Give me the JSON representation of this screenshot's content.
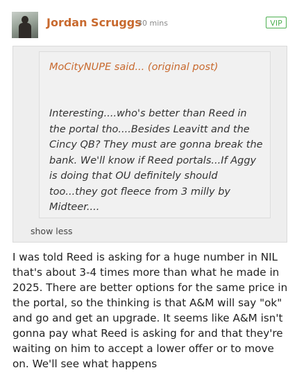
{
  "post": {
    "author": "Jordan Scruggs",
    "timestamp": "30 mins",
    "badge": "VIP",
    "avatar_icon": "user-avatar",
    "quote": {
      "author_text": "MoCityNUPE said...",
      "link_open": "(",
      "link_text": "original post",
      "link_close": ")",
      "text": "Interesting....who's better than Reed in the portal tho....Besides Leavitt and the Cincy QB? They must are gonna break the bank. We'll know if Reed portals...If Aggy is doing that OU definitely should too...they got fleece from 3 milly by Midteer....",
      "toggle_label": "show less"
    },
    "body": "I was told Reed is asking for a huge number in NIL that's about 3-4 times more than what he made in 2025. There are better options for the same price in the portal, so the thinking is that A&M will say \"ok\" and go and get an upgrade. It seems like A&M isn't gonna pay what Reed is asking for and that they're waiting on him to accept a lower offer or to move on. We'll see what happens"
  },
  "colors": {
    "accent": "#c8692e",
    "vip": "#4caf50",
    "quote_bg": "#eeeeee"
  }
}
